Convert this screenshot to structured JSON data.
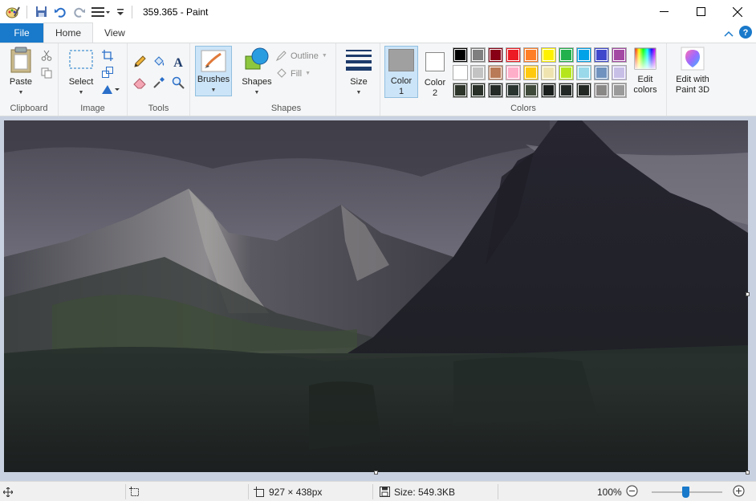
{
  "window": {
    "title": "359.365 - Paint"
  },
  "tabs": {
    "file": "File",
    "home": "Home",
    "view": "View"
  },
  "ribbon": {
    "clipboard": {
      "label": "Clipboard",
      "paste": "Paste"
    },
    "image": {
      "label": "Image",
      "select": "Select"
    },
    "tools": {
      "label": "Tools"
    },
    "brushes": {
      "label": "Brushes"
    },
    "shapes": {
      "label": "Shapes",
      "shapes_btn": "Shapes",
      "outline": "Outline",
      "fill": "Fill"
    },
    "size": {
      "label": "Size"
    },
    "colors": {
      "label": "Colors",
      "color1": "Color",
      "color1_num": "1",
      "color2": "Color",
      "color2_num": "2",
      "edit_colors_1": "Edit",
      "edit_colors_2": "colors",
      "color1_value": "#a0a0a0",
      "color2_value": "#ffffff",
      "palette_row1": [
        "#000000",
        "#7f7f7f",
        "#880015",
        "#ed1c24",
        "#ff7f27",
        "#fff200",
        "#22b14c",
        "#00a2e8",
        "#3f48cc",
        "#a349a4"
      ],
      "palette_row2": [
        "#ffffff",
        "#c3c3c3",
        "#b97a57",
        "#ffaec9",
        "#ffc90e",
        "#efe4b0",
        "#b5e61d",
        "#99d9ea",
        "#7092be",
        "#c8bfe7"
      ],
      "palette_row3": [
        "#2d3429",
        "#283028",
        "#242a26",
        "#2a3530",
        "#404a3a",
        "#1a1e1c",
        "#222825",
        "#232824",
        "#8a8787",
        "#9a9a9a"
      ]
    },
    "paint3d": {
      "line1": "Edit with",
      "line2": "Paint 3D"
    }
  },
  "status": {
    "dimensions": "927 × 438px",
    "size": "Size: 549.3KB",
    "zoom": "100%"
  }
}
